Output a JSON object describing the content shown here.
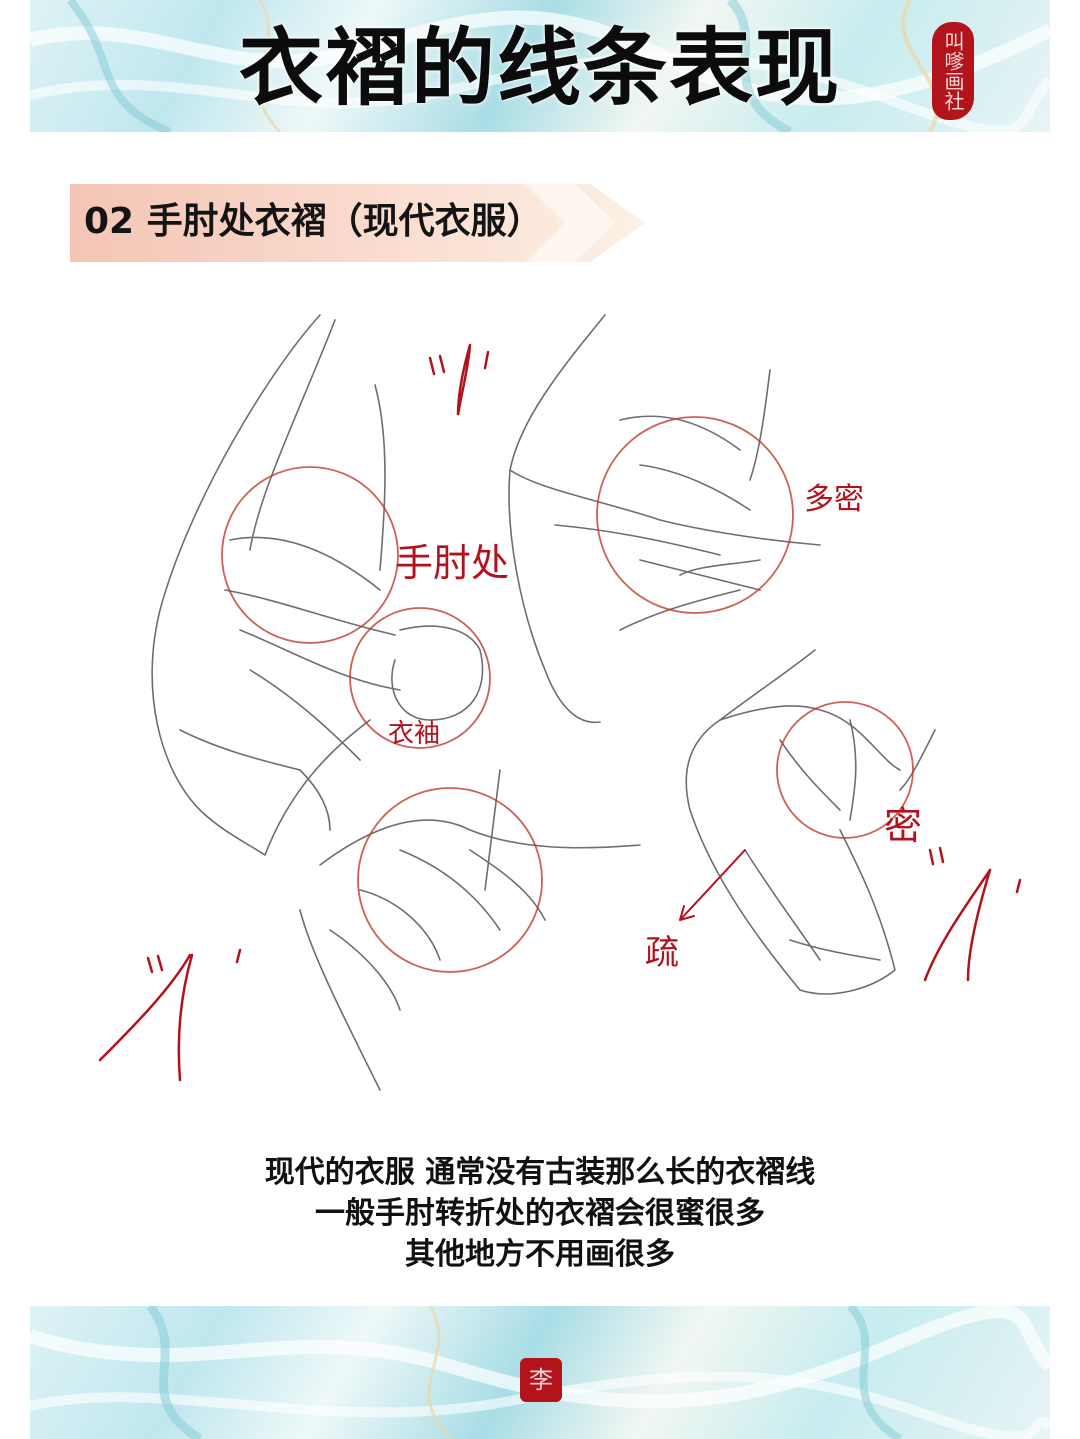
{
  "header": {
    "title": "衣褶的线条表现",
    "seal_text": "叫嗲画社"
  },
  "section": {
    "title": "02 手肘处衣褶（现代衣服）"
  },
  "annotations": {
    "elbow": "手肘处",
    "cuff": "衣袖",
    "many_dense": "多密",
    "dense": "密",
    "sparse": "疏"
  },
  "caption": {
    "line1": "现代的衣服 通常没有古装那么长的衣褶线",
    "line2": "一般手肘转折处的衣褶会很蜜很多",
    "line3": "其他地方不用画很多"
  },
  "footer": {
    "seal_text": "李"
  },
  "colors": {
    "accent_red": "#b3121d",
    "banner_teal": "#a9dde6",
    "section_peach": "#f6cfc0"
  }
}
